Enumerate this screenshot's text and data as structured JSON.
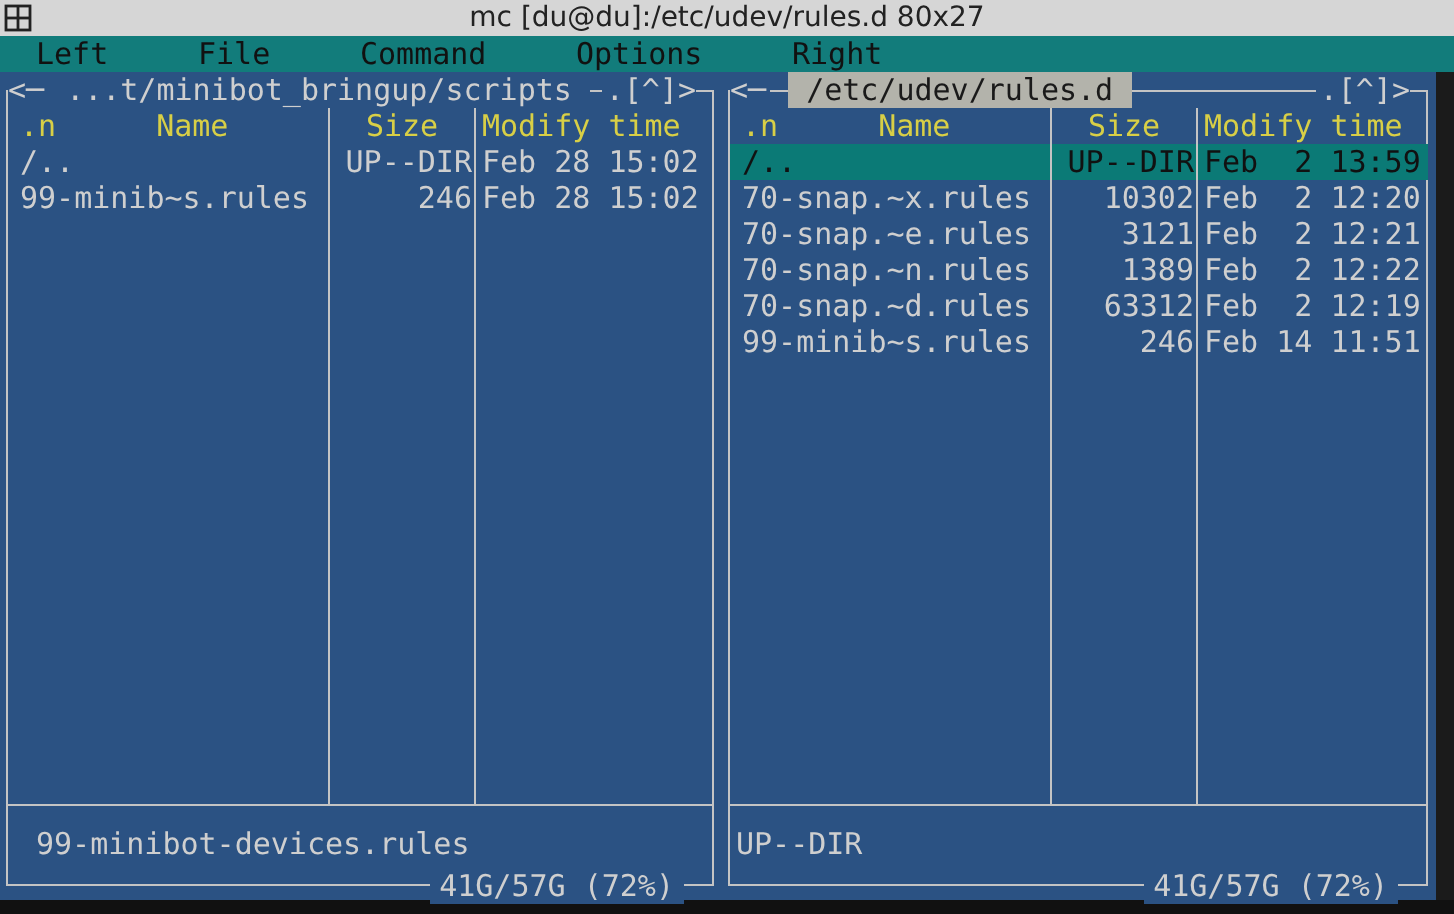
{
  "window": {
    "title": "mc [du@du]:/etc/udev/rules.d 80x27"
  },
  "menu": [
    {
      "label": "Left"
    },
    {
      "label": "File"
    },
    {
      "label": "Command"
    },
    {
      "label": "Options"
    },
    {
      "label": "Right"
    }
  ],
  "panels": [
    {
      "active": false,
      "back": "<─",
      "path": "...t/minibot_bringup/scripts",
      "marker": ".[^]>",
      "columns": [
        ".n",
        "Name",
        "Size",
        "Modify time"
      ],
      "rows": [
        {
          "name": "/..",
          "size": "UP--DIR",
          "time": "Feb 28 15:02",
          "selected": false
        },
        {
          "name": "99-minib~s.rules",
          "size": "246",
          "time": "Feb 28 15:02",
          "selected": false
        }
      ],
      "info": "99-minibot-devices.rules",
      "disk": "41G/57G (72%)"
    },
    {
      "active": true,
      "back": "<─",
      "path": "/etc/udev/rules.d",
      "marker": ".[^]>",
      "columns": [
        ".n",
        "Name",
        "Size",
        "Modify time"
      ],
      "rows": [
        {
          "name": "/..",
          "size": "UP--DIR",
          "time": "Feb  2 13:59",
          "selected": true
        },
        {
          "name": "70-snap.~x.rules",
          "size": "10302",
          "time": "Feb  2 12:20",
          "selected": false
        },
        {
          "name": "70-snap.~e.rules",
          "size": "3121",
          "time": "Feb  2 12:21",
          "selected": false
        },
        {
          "name": "70-snap.~n.rules",
          "size": "1389",
          "time": "Feb  2 12:22",
          "selected": false
        },
        {
          "name": "70-snap.~d.rules",
          "size": "63312",
          "time": "Feb  2 12:19",
          "selected": false
        },
        {
          "name": "99-minib~s.rules",
          "size": "246",
          "time": "Feb 14 11:51",
          "selected": false
        }
      ],
      "info": "UP--DIR",
      "disk": "41G/57G (72%)"
    }
  ]
}
